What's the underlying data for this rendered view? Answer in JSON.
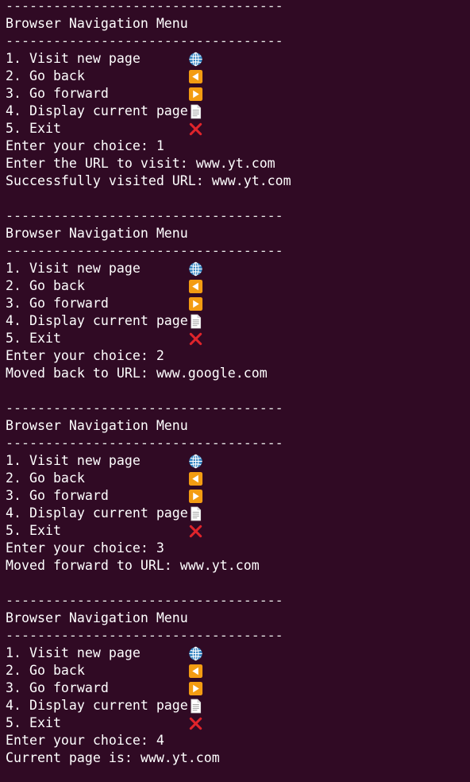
{
  "terminal": {
    "separator": "-----------------------------------",
    "menu_title": "Browser Navigation Menu",
    "menu_items": [
      {
        "label": "1. Visit new page",
        "icon": "globe-icon"
      },
      {
        "label": "2. Go back",
        "icon": "reverse-button-icon"
      },
      {
        "label": "3. Go forward",
        "icon": "play-button-icon"
      },
      {
        "label": "4. Display current page",
        "icon": "page-facing-up-icon"
      },
      {
        "label": "5. Exit",
        "icon": "cross-mark-icon"
      }
    ],
    "blocks": [
      {
        "choice": "Enter your choice: 1",
        "outputs": [
          "Enter the URL to visit: www.yt.com",
          "Successfully visited URL: www.yt.com"
        ]
      },
      {
        "choice": "Enter your choice: 2",
        "outputs": [
          "Moved back to URL: www.google.com"
        ]
      },
      {
        "choice": "Enter your choice: 3",
        "outputs": [
          "Moved forward to URL: www.yt.com"
        ]
      },
      {
        "choice": "Enter your choice: 4",
        "outputs": [
          "Current page is: www.yt.com"
        ]
      }
    ],
    "colors": {
      "background": "#300a24",
      "text": "#ffffff",
      "icon_orange": "#f39c12",
      "icon_red": "#e0242b",
      "icon_globe": "#3b88c3"
    }
  }
}
